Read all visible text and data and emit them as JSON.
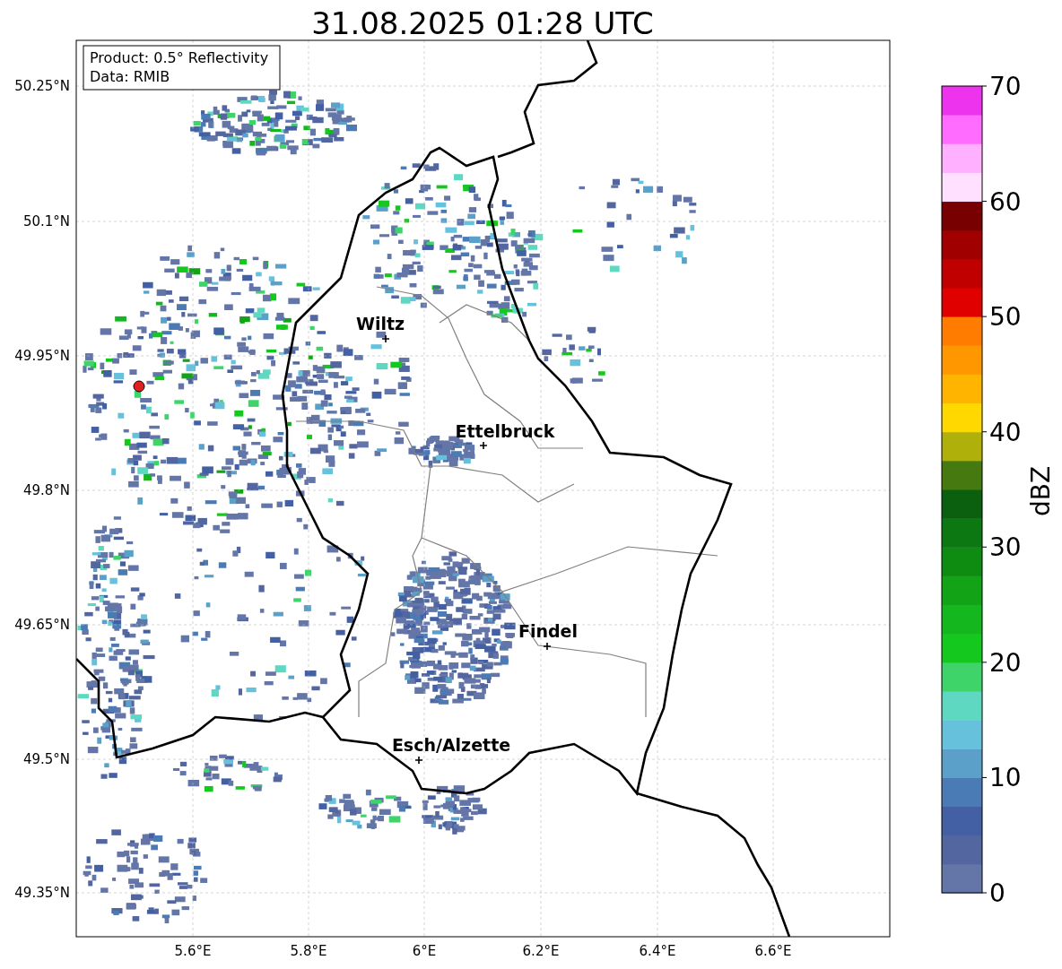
{
  "title": "31.08.2025 01:28 UTC",
  "info_box": [
    "Product: 0.5° Reflectivity",
    "Data: RMIB"
  ],
  "map": {
    "lat_ticks": [
      "50.25°N",
      "50.1°N",
      "49.95°N",
      "49.8°N",
      "49.65°N",
      "49.5°N",
      "49.35°N"
    ],
    "lon_ticks": [
      "5.6°E",
      "5.8°E",
      "6°E",
      "6.2°E",
      "6.4°E",
      "6.6°E"
    ],
    "cities": [
      {
        "name": "Wiltz"
      },
      {
        "name": "Ettelbruck"
      },
      {
        "name": "Findel"
      },
      {
        "name": "Esch/Alzette"
      }
    ]
  },
  "colorbar": {
    "label": "dBZ",
    "ticks": [
      "70",
      "60",
      "50",
      "40",
      "30",
      "20",
      "10",
      "0"
    ],
    "bins": [
      {
        "color": "#6475a8"
      },
      {
        "color": "#5366a0"
      },
      {
        "color": "#4460a4"
      },
      {
        "color": "#4a7bb5"
      },
      {
        "color": "#5aa0c8"
      },
      {
        "color": "#66c2dc"
      },
      {
        "color": "#5ed8c0"
      },
      {
        "color": "#3ed46a"
      },
      {
        "color": "#14c81e"
      },
      {
        "color": "#14b81e"
      },
      {
        "color": "#12a416"
      },
      {
        "color": "#0e8c12"
      },
      {
        "color": "#0c7812"
      },
      {
        "color": "#0a600e"
      },
      {
        "color": "#467a10"
      },
      {
        "color": "#b0b00a"
      },
      {
        "color": "#ffd800"
      },
      {
        "color": "#ffb400"
      },
      {
        "color": "#ff9800"
      },
      {
        "color": "#ff7c00"
      },
      {
        "color": "#e00000"
      },
      {
        "color": "#c00000"
      },
      {
        "color": "#a00000"
      },
      {
        "color": "#780000"
      },
      {
        "color": "#ffe0ff"
      },
      {
        "color": "#ffb0ff"
      },
      {
        "color": "#ff6cff"
      },
      {
        "color": "#ee33ee"
      }
    ]
  }
}
